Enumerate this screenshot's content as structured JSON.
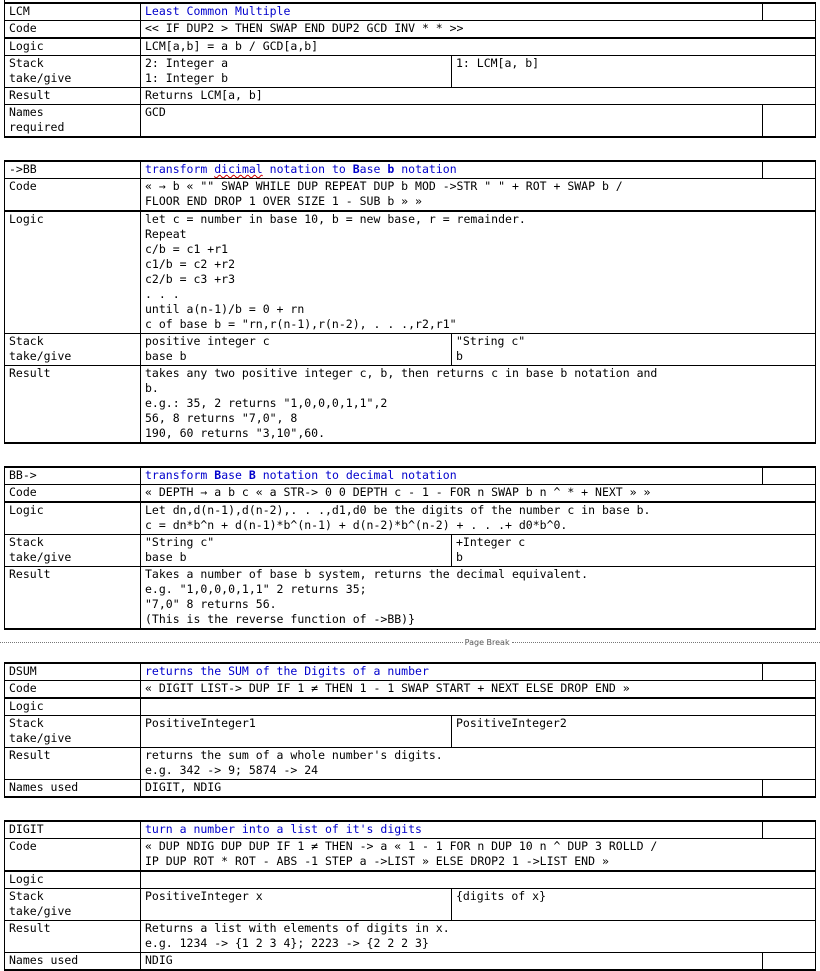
{
  "page_break": {
    "label": "Page Break"
  },
  "row_labels": {
    "code": "Code",
    "logic": "Logic",
    "stack": "Stack\ntake/give",
    "result": "Result",
    "names_required": "Names\nrequired",
    "names_used": "Names used"
  },
  "tables": [
    {
      "name": "LCM",
      "title": "Least Common Multiple",
      "code": "<< IF DUP2 > THEN SWAP END DUP2 GCD INV * * >>",
      "logic": "LCM[a,b] = a b / GCD[a,b]",
      "stack_take": "2: Integer a\n1: Integer b",
      "stack_give": "1: LCM[a, b]",
      "result": "Returns LCM[a, b]",
      "names_label": "Names\nrequired",
      "names": "GCD"
    },
    {
      "name": "->BB",
      "title": "transform dicimal notation to Base b notation",
      "title_parts": [
        {
          "text": "transform ",
          "bold": false
        },
        {
          "text": "dicimal",
          "bold": false,
          "squiggle": "red"
        },
        {
          "text": " notation to ",
          "bold": false
        },
        {
          "text": "B",
          "bold": true
        },
        {
          "text": "ase ",
          "bold": false
        },
        {
          "text": "b",
          "bold": true
        },
        {
          "text": " notation",
          "bold": false
        }
      ],
      "code": "« → b « \"\" SWAP WHILE DUP REPEAT DUP b MOD ->STR \" \" + ROT + SWAP b /\nFLOOR END DROP 1 OVER SIZE 1 - SUB b » »",
      "logic": "let c = number in base 10, b = new base, r = remainder.\nRepeat\nc/b = c1 +r1\nc1/b = c2 +r2\nc2/b = c3 +r3\n. . .\nuntil a(n-1)/b = 0 + rn\nc of base b = \"rn,r(n-1),r(n-2), . . .,r2,r1\"",
      "stack_take": "positive integer c\nbase b",
      "stack_give": "\"String c\"\nb",
      "result": "takes any two positive integer c, b, then returns c in base b notation and\nb.\ne.g.: 35, 2 returns \"1,0,0,0,1,1\",2\n56, 8 returns \"7,0\", 8\n190, 60 returns \"3,10\",60."
    },
    {
      "name": "BB->",
      "title": "transform Base B notation to decimal notation",
      "title_parts": [
        {
          "text": "transform ",
          "bold": false
        },
        {
          "text": "B",
          "bold": true
        },
        {
          "text": "ase ",
          "bold": false
        },
        {
          "text": "B",
          "bold": true
        },
        {
          "text": " notation to decimal notation",
          "bold": false
        }
      ],
      "code": "« DEPTH → a b c « a STR-> 0 0 DEPTH c - 1 - FOR n SWAP b n ^ * + NEXT » »",
      "logic": "Let dn,d(n-1),d(n-2),. . .,d1,d0 be the digits of the number c in base b.\nc = dn*b^n + d(n-1)*b^(n-1) + d(n-2)*b^(n-2) + . . .+ d0*b^0.",
      "stack_take": "\"String c\"\nbase b",
      "stack_give": "+Integer c\nb",
      "result": "Takes a number of base b system, returns the decimal equivalent.\ne.g. \"1,0,0,0,1,1\" 2 returns 35;\n\"7,0\" 8 returns 56.\n(This is the reverse function of ->BB)}"
    },
    {
      "name": "DSUM",
      "title": "returns the SUM of the Digits of a number",
      "code": "« DIGIT LIST-> DUP IF 1 ≠ THEN 1 - 1 SWAP START + NEXT ELSE DROP END »",
      "logic": "",
      "stack_take": "PositiveInteger1",
      "stack_give": "PositiveInteger2",
      "result": "returns the sum of a whole number's digits.\ne.g. 342 -> 9; 5874 -> 24",
      "names_label": "Names used",
      "names": "DIGIT, NDIG"
    },
    {
      "name": "DIGIT",
      "title": "turn a number into a list of it's digits",
      "code": "« DUP NDIG DUP DUP IF 1 ≠ THEN -> a « 1 - 1 FOR n DUP 10 n ^ DUP 3 ROLLD /\nIP DUP ROT * ROT - ABS -1 STEP a ->LIST » ELSE DROP2 1 ->LIST END »",
      "logic": "",
      "stack_take": "PositiveInteger x",
      "stack_give": "{digits of x}",
      "result": "Returns a list with elements of digits in x.\ne.g. 1234 -> {1 2 3 4}; 2223 -> {2 2 2 3}",
      "names_label": "Names used",
      "names": "NDIG"
    }
  ],
  "colors": {
    "title_blue": "#0000cc",
    "text": "#000000",
    "border": "#000000",
    "spell_red": "#d00000",
    "spell_green": "#107010"
  }
}
